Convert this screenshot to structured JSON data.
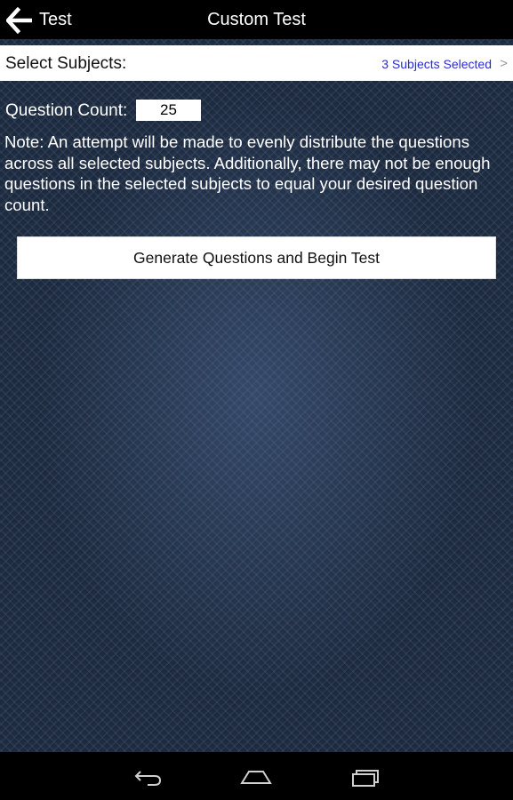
{
  "topbar": {
    "back_label": "Test",
    "title": "Custom Test",
    "back_icon": "arrow-left-icon"
  },
  "subjects": {
    "label": "Select Subjects:",
    "value": "3 Subjects Selected",
    "chevron": ">"
  },
  "question_count": {
    "label": "Question Count:",
    "value": "25"
  },
  "note": "Note: An attempt will be made to evenly distribute the questions across all selected subjects.  Additionally, there may not be enough questions in the selected subjects to equal your desired question count.",
  "generate_button": {
    "label": "Generate Questions and Begin Test"
  },
  "navbar": {
    "back_icon": "nav-back-icon",
    "home_icon": "nav-home-icon",
    "recents_icon": "nav-recents-icon"
  },
  "colors": {
    "accent_link": "#2a2ad6",
    "bar_background": "#000000",
    "content_background": "#1e2c42"
  }
}
